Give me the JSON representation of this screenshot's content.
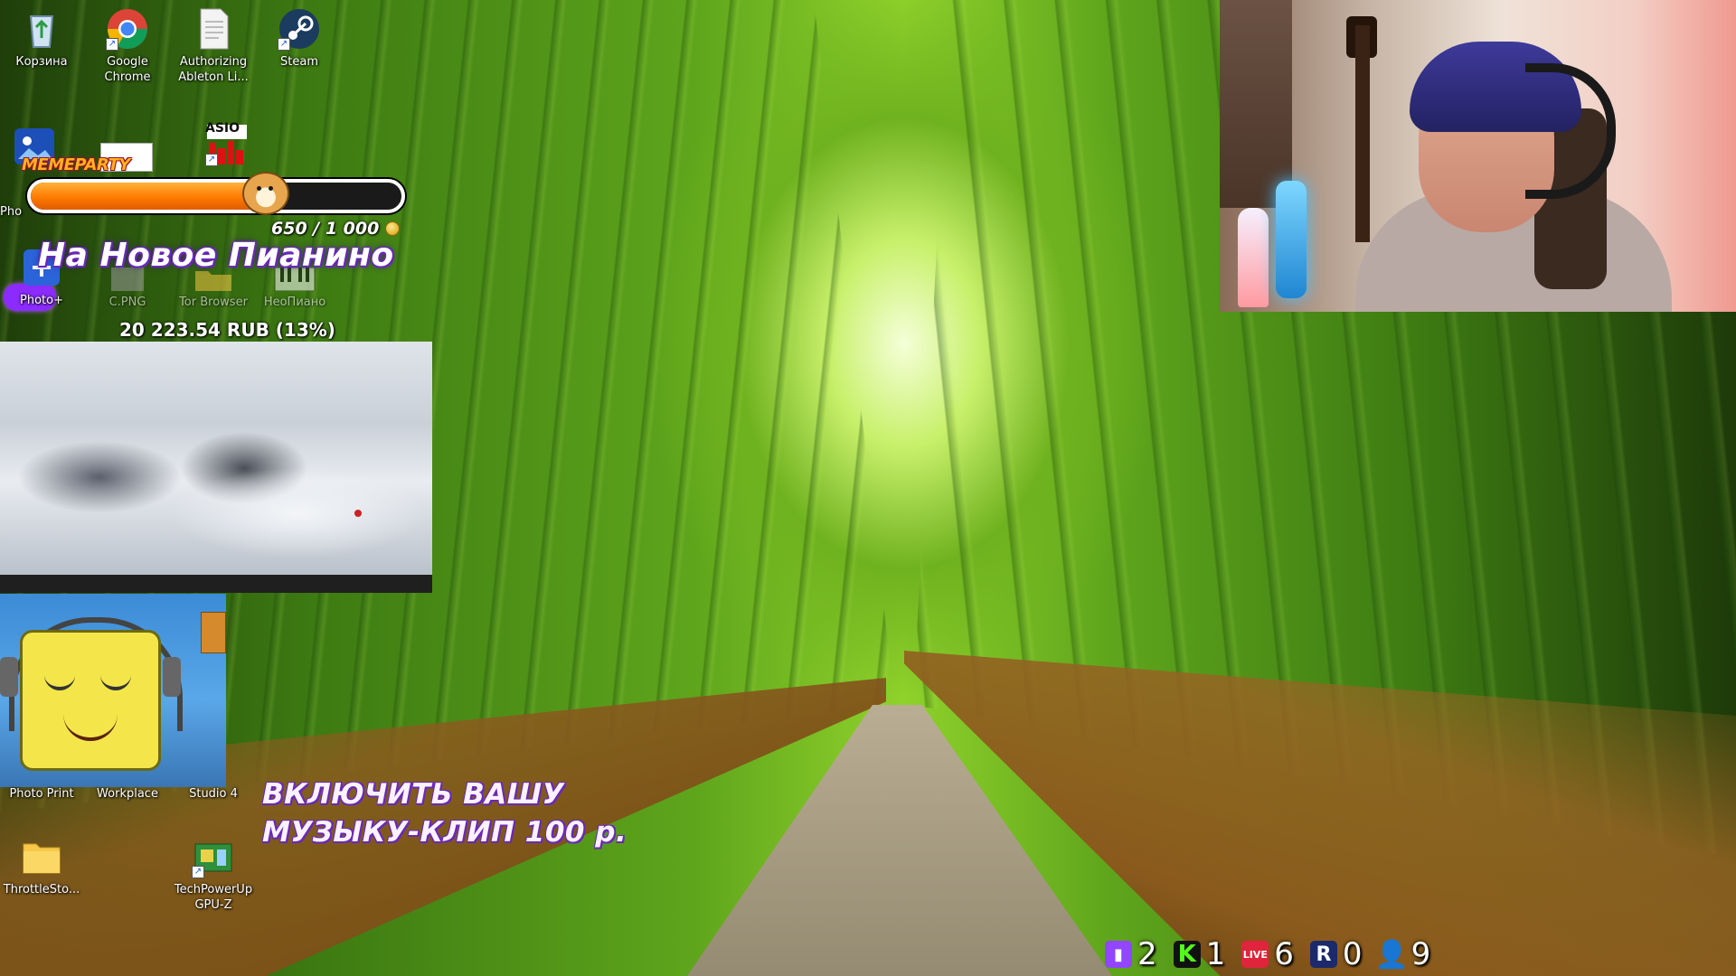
{
  "desktop": {
    "icons": [
      {
        "id": "recycle",
        "label": "Корзина"
      },
      {
        "id": "chrome",
        "label": "Google Chrome"
      },
      {
        "id": "ableton",
        "label": "Authorizing Ableton Li..."
      },
      {
        "id": "steam",
        "label": "Steam"
      },
      {
        "id": "photo-left",
        "label": "Pho"
      },
      {
        "id": "asio",
        "label": "ASIO"
      },
      {
        "id": "photoplus",
        "label": "Photo+"
      },
      {
        "id": "cpng",
        "label": "C.PNG"
      },
      {
        "id": "tor",
        "label": "Tor Browser"
      },
      {
        "id": "neopiano",
        "label": "НеоПиано"
      },
      {
        "id": "photoprint",
        "label": "Photo Print"
      },
      {
        "id": "workplace",
        "label": "Workplace"
      },
      {
        "id": "studio4",
        "label": "Studio 4"
      },
      {
        "id": "throttlestop",
        "label": "ThrottleSto..."
      },
      {
        "id": "gpuz",
        "label": "TechPowerUp GPU-Z"
      }
    ]
  },
  "goal": {
    "brand": "MEMEPARTY",
    "progress": "650 / 1 000",
    "progress_fraction": 0.65,
    "name": "На Новое Пианино",
    "amount": "20 223.54 RUB (13%)",
    "bar_color": "#ff7a00"
  },
  "promo": {
    "line1": "ВКЛЮЧИТЬ ВАШУ",
    "line2": "МУЗЫКУ-КЛИП 100 р."
  },
  "counters": [
    {
      "platform": "twitch-icon",
      "value": "2"
    },
    {
      "platform": "kick-icon",
      "value": "1"
    },
    {
      "platform": "live-icon",
      "value": "6"
    },
    {
      "platform": "rumble-icon",
      "value": "0"
    },
    {
      "platform": "viewers-icon",
      "value": "9"
    }
  ],
  "colors": {
    "accent_purple": "#6a28b8",
    "twitch": "#9146ff",
    "kick": "#53fc18",
    "live": "#e0243b"
  }
}
